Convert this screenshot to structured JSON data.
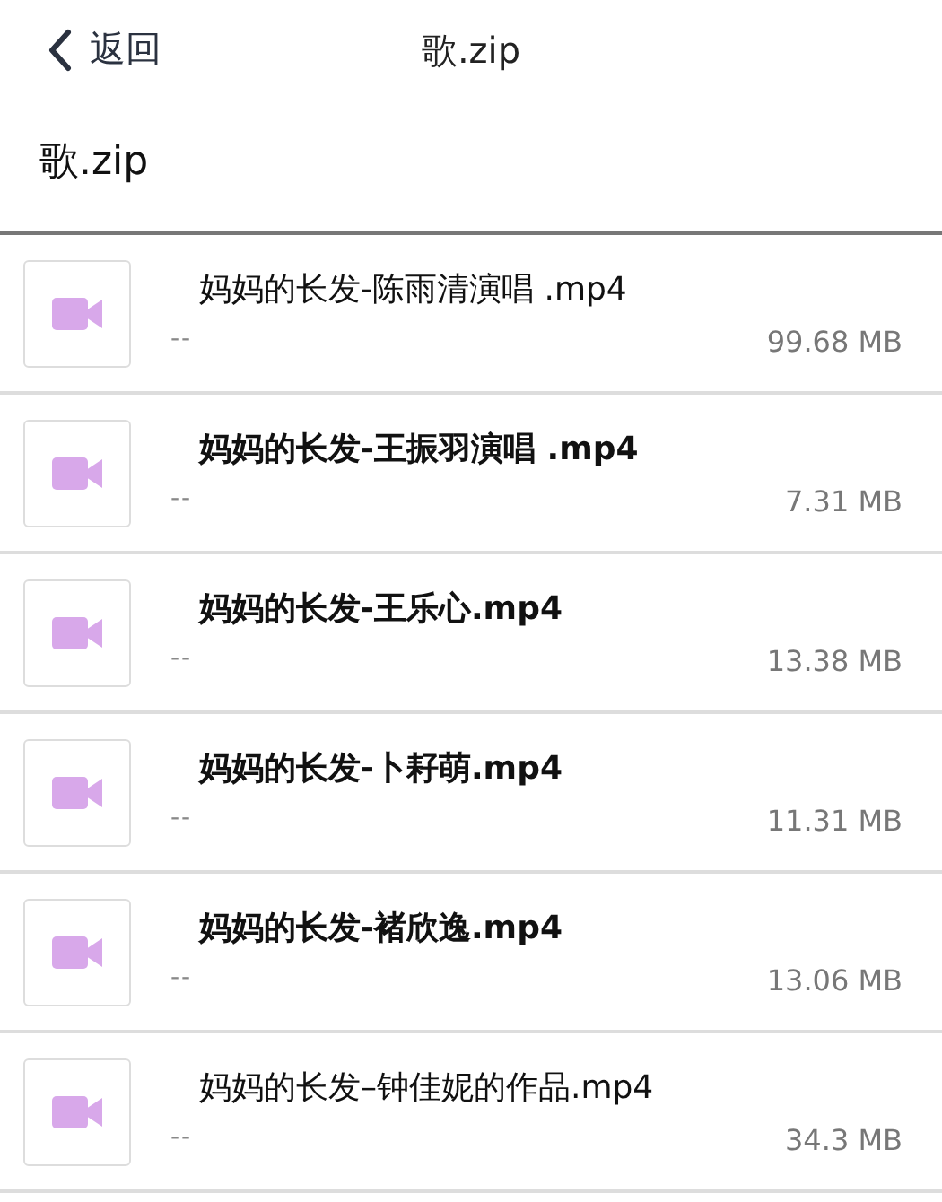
{
  "nav": {
    "back": "返回",
    "title": "歌.zip"
  },
  "folder": "歌.zip",
  "files": [
    {
      "name": "妈妈的长发-陈雨清演唱 .mp4",
      "bold": false,
      "date": "--",
      "size": "99.68 MB"
    },
    {
      "name": "妈妈的长发-王振羽演唱 .mp4",
      "bold": true,
      "date": "--",
      "size": "7.31 MB"
    },
    {
      "name": "妈妈的长发-王乐心.mp4",
      "bold": true,
      "date": "--",
      "size": "13.38 MB"
    },
    {
      "name": "妈妈的长发-卜耔萌.mp4",
      "bold": true,
      "date": "--",
      "size": "11.31 MB"
    },
    {
      "name": "妈妈的长发-褚欣逸.mp4",
      "bold": true,
      "date": "--",
      "size": "13.06 MB"
    },
    {
      "name": "妈妈的长发–钟佳妮的作品.mp4",
      "bold": false,
      "date": "--",
      "size": "34.3 MB"
    }
  ]
}
